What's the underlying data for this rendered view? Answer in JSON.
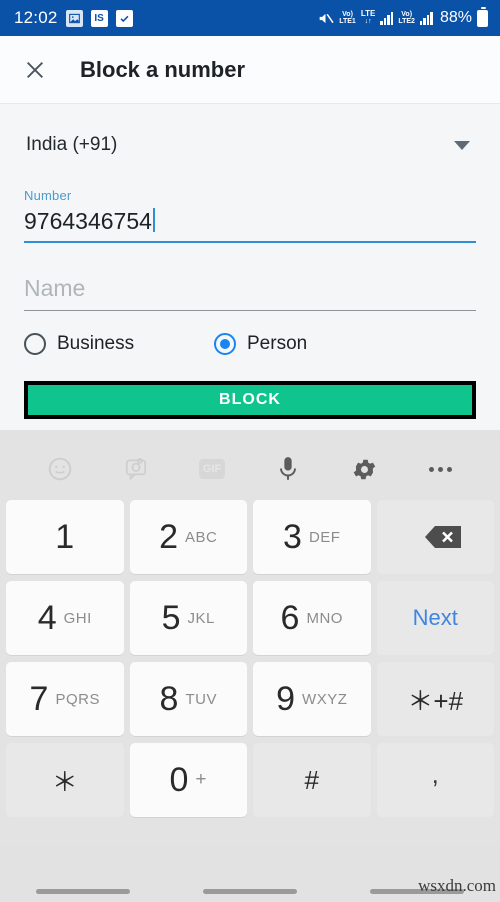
{
  "status_bar": {
    "time": "12:02",
    "left_icons": [
      {
        "name": "photo-icon",
        "label": "❑"
      },
      {
        "name": "is-app-icon",
        "label": "IS"
      },
      {
        "name": "checkbox-icon",
        "label": "✔"
      }
    ],
    "mute_icon": "mute-icon",
    "sim1_volte": "Vo)",
    "sim1_label": "LTE1",
    "lte_label": "LTE",
    "data_arrows": "↓↑",
    "sim2_volte": "Vo)",
    "sim2_label": "LTE2",
    "battery_percent": "88%",
    "background_color": "#0a51a8"
  },
  "app_bar": {
    "close_label": "✕",
    "title": "Block a number"
  },
  "form": {
    "country": {
      "value": "India (+91)",
      "caret": "chevron-down"
    },
    "number_field": {
      "label": "Number",
      "value": "9764346754",
      "accent_color": "#2f8fd6"
    },
    "name_field": {
      "placeholder": "Name",
      "value": ""
    },
    "type_options": [
      {
        "label": "Business",
        "selected": false
      },
      {
        "label": "Person",
        "selected": true
      }
    ],
    "selected_color": "#1a85f0"
  },
  "block_button": {
    "label": "BLOCK",
    "background_color": "#10c48d",
    "highlight_border_color": "#000000"
  },
  "keyboard": {
    "toolbar": [
      {
        "name": "emoji-icon",
        "faded": true
      },
      {
        "name": "sticker-icon",
        "faded": true
      },
      {
        "name": "gif-icon",
        "label": "GIF",
        "faded": true
      },
      {
        "name": "microphone-icon",
        "faded": false
      },
      {
        "name": "settings-gear-icon",
        "faded": false
      },
      {
        "name": "more-options-icon",
        "faded": false
      }
    ],
    "rows": [
      [
        {
          "name": "key-1",
          "num": "1",
          "sub": "",
          "style": "white"
        },
        {
          "name": "key-2",
          "num": "2",
          "sub": "ABC",
          "style": "white"
        },
        {
          "name": "key-3",
          "num": "3",
          "sub": "DEF",
          "style": "white"
        },
        {
          "name": "key-backspace",
          "icon": "backspace-icon",
          "style": "gray"
        }
      ],
      [
        {
          "name": "key-4",
          "num": "4",
          "sub": "GHI",
          "style": "white"
        },
        {
          "name": "key-5",
          "num": "5",
          "sub": "JKL",
          "style": "white"
        },
        {
          "name": "key-6",
          "num": "6",
          "sub": "MNO",
          "style": "white"
        },
        {
          "name": "key-next",
          "text": "Next",
          "style": "gray"
        }
      ],
      [
        {
          "name": "key-7",
          "num": "7",
          "sub": "PQRS",
          "style": "white"
        },
        {
          "name": "key-8",
          "num": "8",
          "sub": "TUV",
          "style": "white"
        },
        {
          "name": "key-9",
          "num": "9",
          "sub": "WXYZ",
          "style": "white"
        },
        {
          "name": "key-symbols",
          "sym": "＊+#",
          "style": "gray"
        }
      ],
      [
        {
          "name": "key-asterisk",
          "sym": "＊",
          "style": "gray"
        },
        {
          "name": "key-0",
          "num": "0",
          "sub": "+",
          "style": "white"
        },
        {
          "name": "key-hash",
          "sym": "#",
          "style": "gray"
        },
        {
          "name": "key-comma",
          "comma": ",",
          "style": "gray"
        }
      ]
    ]
  },
  "nav_bar": {
    "pills": [
      "recents-pill",
      "home-pill",
      "back-pill"
    ]
  },
  "watermark": "wsxdn.com"
}
